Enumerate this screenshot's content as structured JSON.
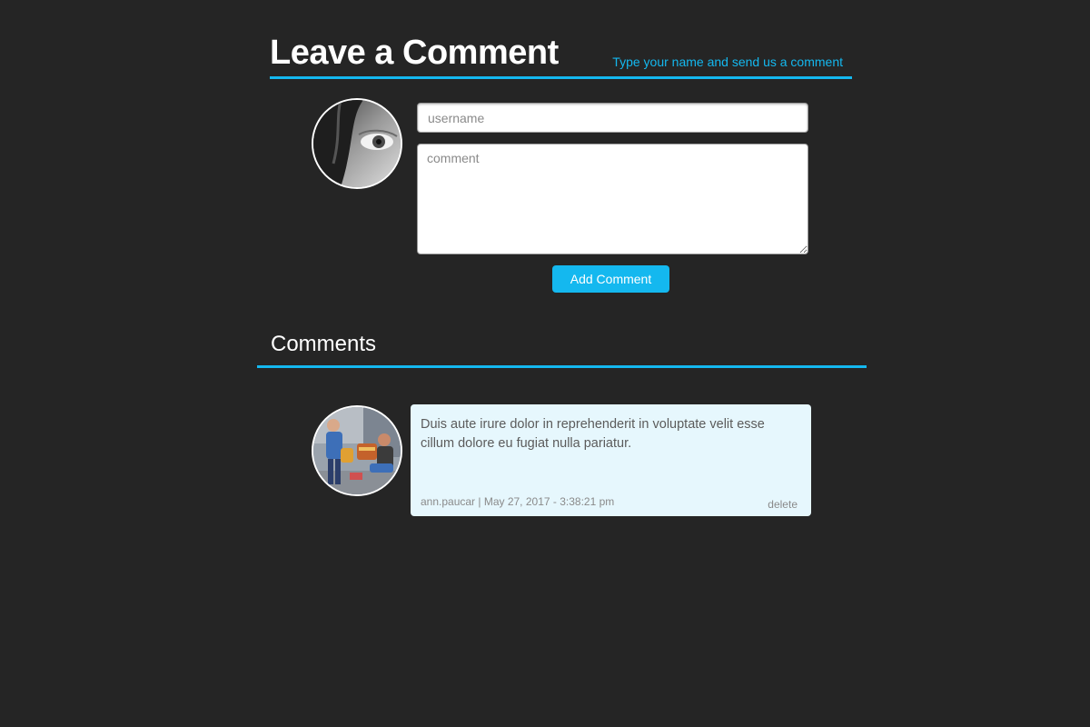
{
  "form": {
    "title": "Leave a Comment",
    "subtitle": "Type your name and send us a comment",
    "username_placeholder": "username",
    "comment_placeholder": "comment",
    "submit_label": "Add Comment"
  },
  "comments_section": {
    "title": "Comments",
    "items": [
      {
        "text": "Duis aute irure dolor in reprehenderit in voluptate velit esse cillum dolore eu fugiat nulla pariatur.",
        "meta": "ann.paucar | May 27, 2017 - 3:38:21 pm",
        "delete_label": "delete"
      }
    ]
  },
  "colors": {
    "background": "#252525",
    "accent": "#14b8ef",
    "comment_card": "#e6f7fd"
  },
  "icons": {
    "form_avatar": "avatar-icon",
    "comment_avatar": "avatar-icon"
  }
}
